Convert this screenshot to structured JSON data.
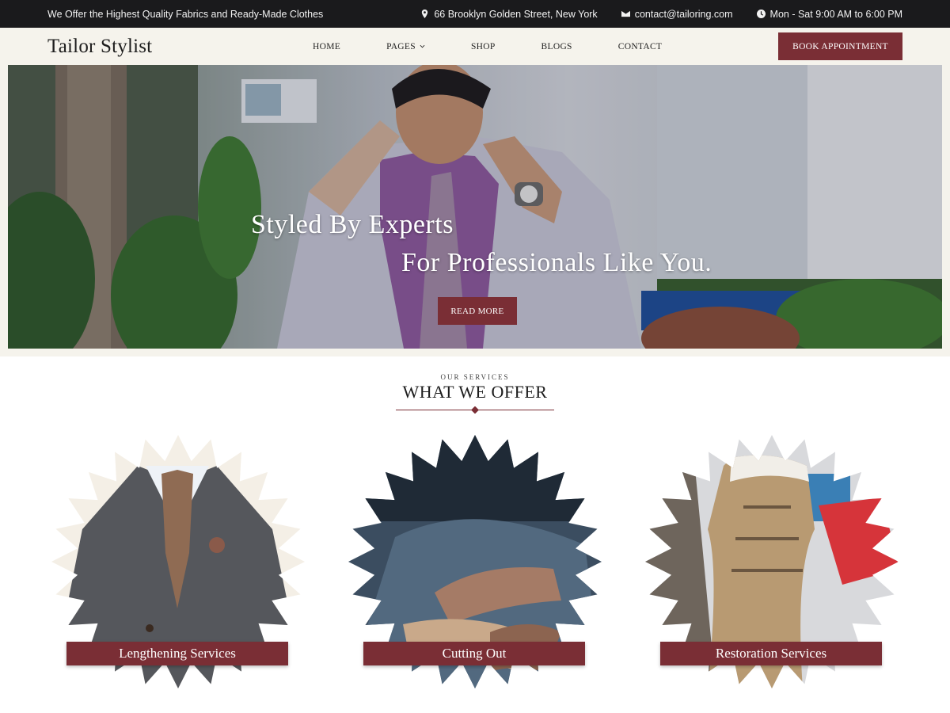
{
  "topbar": {
    "tagline": "We Offer the Highest Quality Fabrics and Ready-Made Clothes",
    "address": "66 Brooklyn Golden Street, New York",
    "email": "contact@tailoring.com",
    "hours": "Mon - Sat 9:00 AM to 6:00 PM"
  },
  "header": {
    "logo": "Tailor Stylist",
    "nav": [
      "HOME",
      "PAGES",
      "SHOP",
      "BLOGS",
      "CONTACT"
    ],
    "cta": "BOOK APPOINTMENT"
  },
  "hero": {
    "title_line1": "Styled By Experts",
    "title_line2": "For Professionals Like You.",
    "button": "READ MORE"
  },
  "services": {
    "eyebrow": "OUR SERVICES",
    "title": "WHAT WE OFFER",
    "items": [
      {
        "label": "Lengthening Services"
      },
      {
        "label": "Cutting Out"
      },
      {
        "label": "Restoration Services"
      }
    ]
  },
  "colors": {
    "accent": "#7a2e35",
    "topbar": "#1a1a1c",
    "header": "#f5f3ec"
  }
}
